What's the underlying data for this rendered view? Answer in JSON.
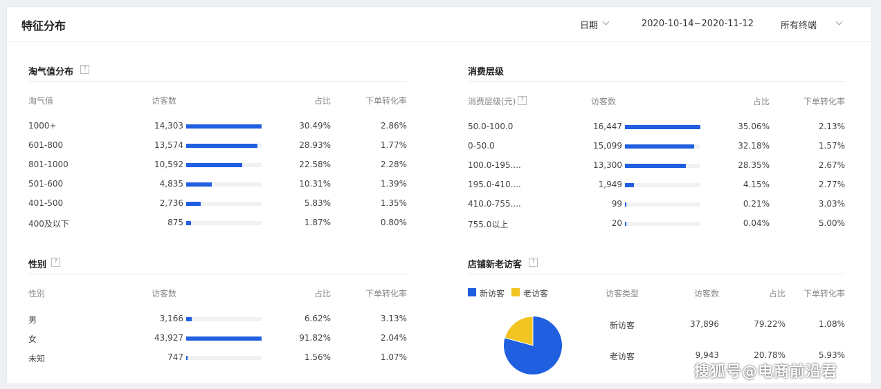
{
  "header": {
    "title": "特征分布",
    "date_label": "日期",
    "date_range": "2020-10-14~2020-11-12",
    "terminal": "所有终端"
  },
  "colors": {
    "accent": "#1f5fe0",
    "old_visitor": "#f2c522",
    "track": "#f0f1f3"
  },
  "taoqi": {
    "title": "淘气值分布",
    "help": "?",
    "columns": [
      "淘气值",
      "访客数",
      "占比",
      "下单转化率"
    ],
    "rows": [
      {
        "label": "1000+",
        "visitors": "14,303",
        "share": "30.49%",
        "conv": "2.86%",
        "fill": 1.0
      },
      {
        "label": "601-800",
        "visitors": "13,574",
        "share": "28.93%",
        "conv": "1.77%",
        "fill": 0.949
      },
      {
        "label": "801-1000",
        "visitors": "10,592",
        "share": "22.58%",
        "conv": "2.28%",
        "fill": 0.741
      },
      {
        "label": "501-600",
        "visitors": "4,835",
        "share": "10.31%",
        "conv": "1.39%",
        "fill": 0.338
      },
      {
        "label": "401-500",
        "visitors": "2,736",
        "share": "5.83%",
        "conv": "1.35%",
        "fill": 0.191
      },
      {
        "label": "400及以下",
        "visitors": "875",
        "share": "1.87%",
        "conv": "0.80%",
        "fill": 0.061
      }
    ]
  },
  "consumption": {
    "title": "消费层级",
    "columns": [
      "消费层级(元)",
      "访客数",
      "占比",
      "下单转化率"
    ],
    "help": "?",
    "rows": [
      {
        "label": "50.0-100.0",
        "visitors": "16,447",
        "share": "35.06%",
        "conv": "2.13%",
        "fill": 1.0
      },
      {
        "label": "0-50.0",
        "visitors": "15,099",
        "share": "32.18%",
        "conv": "1.57%",
        "fill": 0.918
      },
      {
        "label": "100.0-195....",
        "visitors": "13,300",
        "share": "28.35%",
        "conv": "2.67%",
        "fill": 0.809
      },
      {
        "label": "195.0-410....",
        "visitors": "1,949",
        "share": "4.15%",
        "conv": "2.77%",
        "fill": 0.118
      },
      {
        "label": "410.0-755....",
        "visitors": "99",
        "share": "0.21%",
        "conv": "3.03%",
        "fill": 0.006
      },
      {
        "label": "755.0以上",
        "visitors": "20",
        "share": "0.04%",
        "conv": "5.00%",
        "fill": 0.0012
      }
    ]
  },
  "gender": {
    "title": "性别",
    "help": "?",
    "columns": [
      "性别",
      "访客数",
      "占比",
      "下单转化率"
    ],
    "rows": [
      {
        "label": "男",
        "visitors": "3,166",
        "share": "6.62%",
        "conv": "3.13%",
        "fill": 0.072
      },
      {
        "label": "女",
        "visitors": "43,927",
        "share": "91.82%",
        "conv": "2.04%",
        "fill": 1.0
      },
      {
        "label": "未知",
        "visitors": "747",
        "share": "1.56%",
        "conv": "1.07%",
        "fill": 0.017
      }
    ]
  },
  "visitors": {
    "title": "店铺新老访客",
    "help": "?",
    "legend": [
      "新访客",
      "老访客"
    ],
    "columns": [
      "访客类型",
      "访客数",
      "占比",
      "下单转化率"
    ],
    "rows": [
      {
        "label": "新访客",
        "visitors": "37,896",
        "share": "79.22%",
        "conv": "1.08%"
      },
      {
        "label": "老访客",
        "visitors": "9,943",
        "share": "20.78%",
        "conv": "5.93%"
      }
    ],
    "pie": {
      "new_share": 79.22,
      "old_share": 20.78
    }
  },
  "watermark": "搜狐号@电商前沿君"
}
